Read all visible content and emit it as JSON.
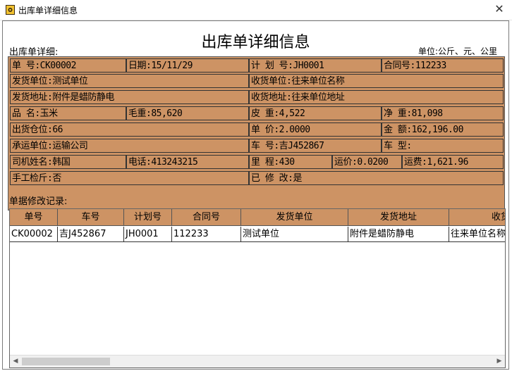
{
  "window": {
    "title": "出库单详细信息",
    "close_label": "✕"
  },
  "heading": "出库单详细信息",
  "subtitle_left": "出库单详细:",
  "subtitle_right": "单位:公斤、元、公里",
  "info": {
    "r1": [
      "单    号:CK00002",
      "日期:15/11/29",
      "计 划 号:JH0001",
      "合同号:112233"
    ],
    "r2": [
      "发货单位:测试单位",
      "收货单位:往来单位名称"
    ],
    "r3": [
      "发货地址:附件是蜡防静电",
      "收货地址:往来单位地址"
    ],
    "r4": [
      "品    名:玉米",
      "毛重:85,620",
      "皮    重:4,522",
      "净  重:81,098"
    ],
    "r5": [
      "出货仓位:66",
      "单    价:2.0000",
      "金  额:162,196.00"
    ],
    "r6": [
      "承运单位:运输公司",
      "车    号:吉J452867",
      "车  型:"
    ],
    "r7": [
      "司机姓名:韩国",
      "电话:413243215",
      "里    程:430",
      "运价:0.0200",
      "运费:1,621.96"
    ],
    "r8": [
      "手工检斤:否",
      "已 修 改:是"
    ]
  },
  "records_label": "单据修改记录:",
  "grid": {
    "columns": [
      "单号",
      "车号",
      "计划号",
      "合同号",
      "发货单位",
      "发货地址",
      "收货"
    ],
    "rows": [
      [
        "CK00002",
        "吉J452867",
        "JH0001",
        "112233",
        "测试单位",
        "附件是蜡防静电",
        "往来单位名称"
      ]
    ]
  },
  "scrollbar": {
    "left_arrow": "◀",
    "right_arrow": "▶"
  }
}
